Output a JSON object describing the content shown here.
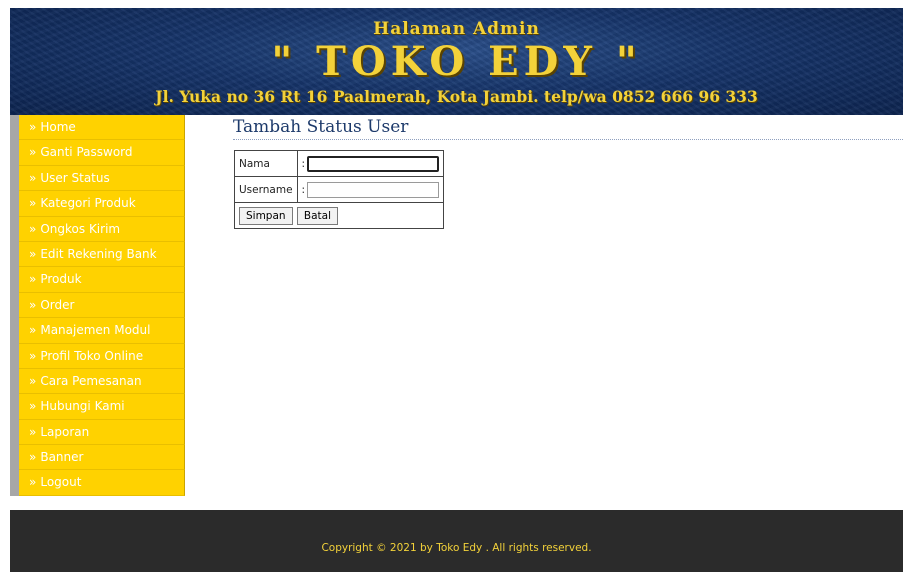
{
  "header": {
    "subtitle": "Halaman Admin",
    "title": "\" TOKO EDY \"",
    "address": "Jl. Yuka no 36 Rt 16 Paalmerah, Kota Jambi. telp/wa 0852 666 96 333"
  },
  "sidebar": {
    "items": [
      {
        "label": "Home"
      },
      {
        "label": "Ganti Password"
      },
      {
        "label": "User Status"
      },
      {
        "label": "Kategori Produk"
      },
      {
        "label": "Ongkos Kirim"
      },
      {
        "label": "Edit Rekening Bank"
      },
      {
        "label": "Produk"
      },
      {
        "label": "Order"
      },
      {
        "label": "Manajemen Modul"
      },
      {
        "label": "Profil Toko Online"
      },
      {
        "label": "Cara Pemesanan"
      },
      {
        "label": "Hubungi Kami"
      },
      {
        "label": "Laporan"
      },
      {
        "label": "Banner"
      },
      {
        "label": "Logout"
      }
    ],
    "arrow": "»"
  },
  "main": {
    "title": "Tambah Status User",
    "form": {
      "nama_label": "Nama",
      "nama_value": "",
      "username_label": "Username",
      "username_value": "",
      "colon": ":",
      "save_label": "Simpan",
      "cancel_label": "Batal"
    }
  },
  "footer": {
    "text": "Copyright © 2021 by Toko Edy . All rights reserved."
  },
  "colors": {
    "sidebar_bg": "#ffd200",
    "header_bg": "#16346a",
    "header_text": "#f3d23a",
    "footer_bg": "#2b2b2b"
  }
}
